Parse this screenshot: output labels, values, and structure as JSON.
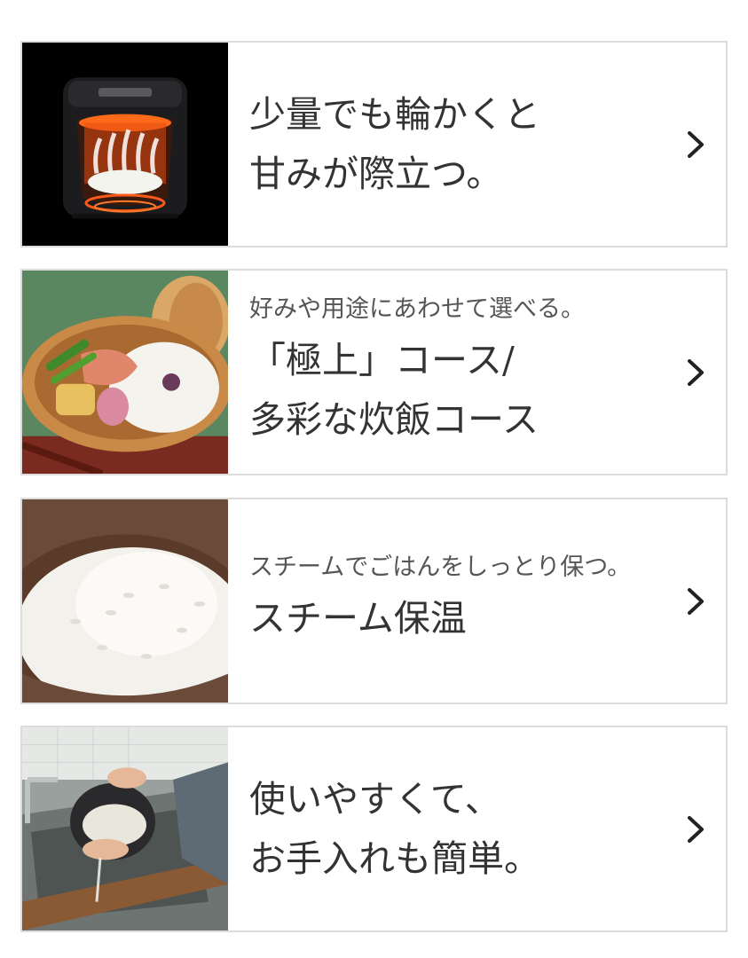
{
  "cards": [
    {
      "image_name": "rice-cooker-heating-image",
      "subtitle": "",
      "title_lines": [
        "少量でも輪かくと",
        "甘みが際立つ。"
      ]
    },
    {
      "image_name": "bento-box-image",
      "subtitle": "好みや用途にあわせて選べる。",
      "title_lines": [
        "「極上」コース/",
        "多彩な炊飯コース"
      ]
    },
    {
      "image_name": "rice-bowl-image",
      "subtitle": "スチームでごはんをしっとり保つ。",
      "title_lines": [
        "スチーム保温"
      ]
    },
    {
      "image_name": "washing-rice-image",
      "subtitle": "",
      "title_lines": [
        "使いやすくて、",
        "お手入れも簡単。"
      ]
    }
  ],
  "icons": {
    "chevron": "chevron-right-icon"
  },
  "colors": {
    "border": "#dcdcdc",
    "text": "#333333",
    "subtext": "#555555"
  }
}
